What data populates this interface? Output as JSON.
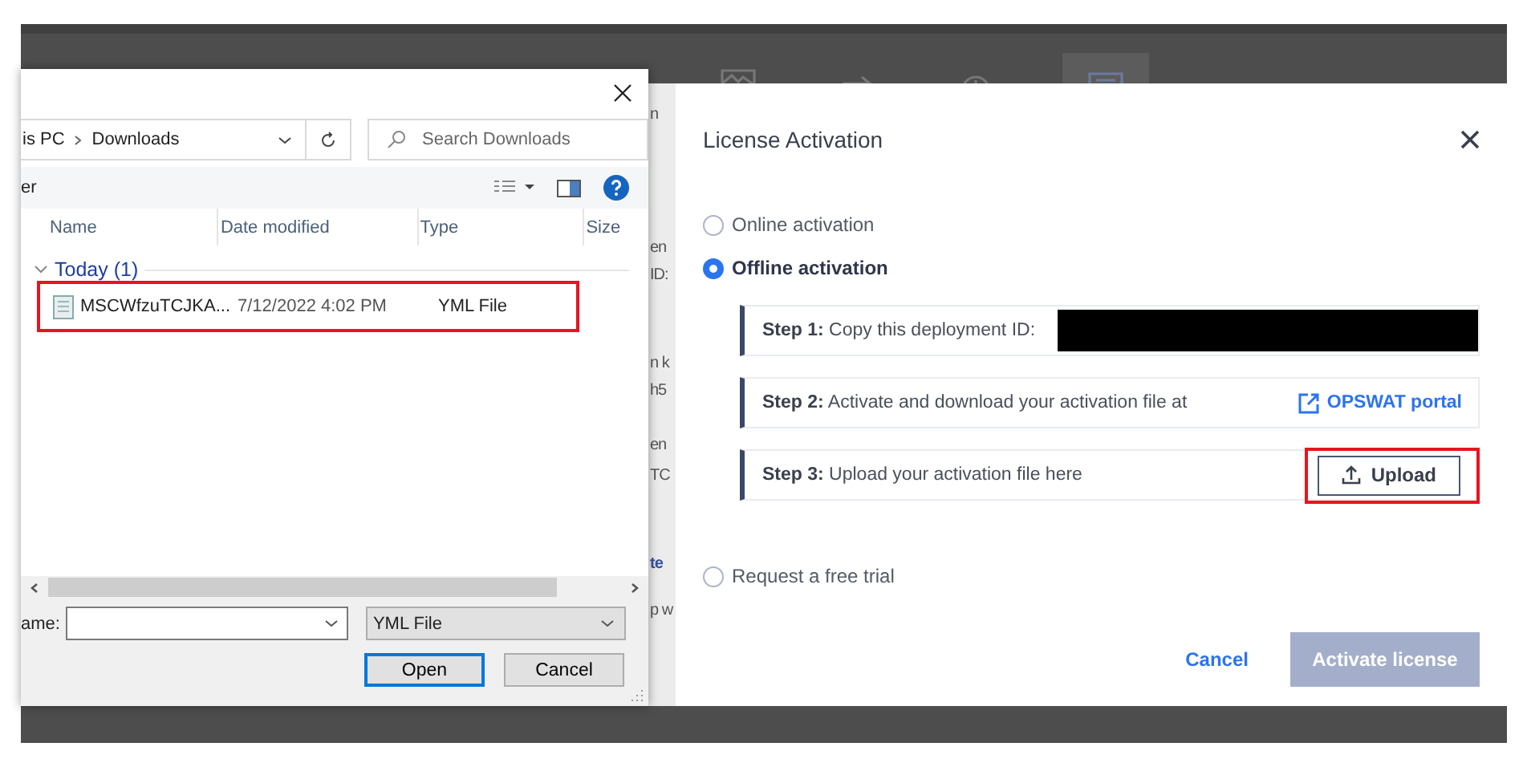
{
  "background_app": {
    "toolbar_icons": [
      {
        "kind": "chart",
        "selected": false
      },
      {
        "kind": "arrow",
        "selected": false
      },
      {
        "kind": "info",
        "selected": false
      },
      {
        "kind": "license",
        "selected": true
      }
    ],
    "text_fragments": [
      {
        "text": "n",
        "kind": "plain"
      },
      {
        "text": "en",
        "kind": "plain"
      },
      {
        "text": "ID:",
        "kind": "plain"
      },
      {
        "text": "n k",
        "kind": "plain"
      },
      {
        "text": "h5",
        "kind": "plain"
      },
      {
        "text": "en",
        "kind": "plain"
      },
      {
        "text": "TC",
        "kind": "plain"
      },
      {
        "text": "te",
        "kind": "link"
      },
      {
        "text": "p w",
        "kind": "plain"
      }
    ]
  },
  "file_dialog": {
    "address": [
      "is PC",
      "Downloads"
    ],
    "search": {
      "placeholder": "Search Downloads"
    },
    "toolbar_text": "er",
    "columns": [
      "Name",
      "Date modified",
      "Type",
      "Size"
    ],
    "groups": [
      {
        "label": "Today (1)",
        "expanded": true,
        "files": [
          {
            "name": "MSCWfzuTCJKA...",
            "date": "7/12/2022 4:02 PM",
            "type": "YML File",
            "highlighted": true
          }
        ]
      }
    ],
    "file_name_label": "ame:",
    "file_type": "YML File",
    "buttons": [
      {
        "label": "Open",
        "default": true
      },
      {
        "label": "Cancel",
        "default": false
      }
    ]
  },
  "license_dialog": {
    "title": "License Activation",
    "options": [
      {
        "label": "Online activation",
        "selected": false
      },
      {
        "label": "Offline activation",
        "selected": true,
        "steps": [
          {
            "kind": "copy_id",
            "text": "**Step 1:** Copy this deployment ID:",
            "redacted": true
          },
          {
            "kind": "link",
            "text": "**Step 2:** Activate and download your activation file at",
            "action": "OPSWAT portal"
          },
          {
            "kind": "upload",
            "text": "**Step 3:** Upload your activation file here",
            "action": "Upload",
            "highlighted": true
          }
        ]
      },
      {
        "label": "Request a free trial",
        "selected": false
      }
    ],
    "cancel": "Cancel",
    "submit": {
      "label": "Activate license",
      "disabled": true
    }
  }
}
